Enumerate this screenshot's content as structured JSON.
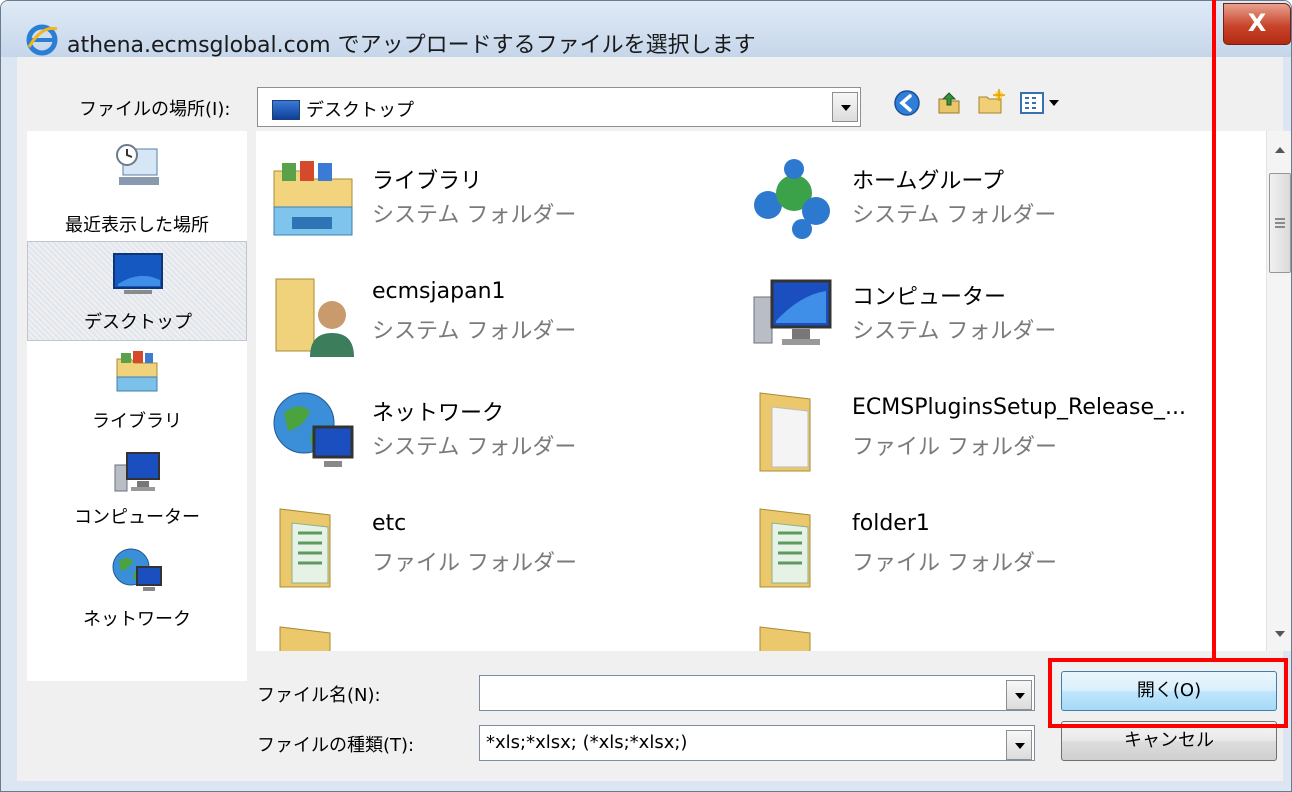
{
  "window": {
    "title": "athena.ecmsglobal.com でアップロードするファイルを選択します",
    "close_label": "X",
    "title_icon": "ie-icon"
  },
  "toolbar": {
    "location_label": "ファイルの場所(I):",
    "location_value": "デスクトップ",
    "icons": [
      "back-icon",
      "up-folder-icon",
      "new-folder-icon",
      "view-menu-icon"
    ]
  },
  "places": [
    {
      "label": "最近表示した場所",
      "icon": "recent-places-icon"
    },
    {
      "label": "デスクトップ",
      "icon": "desktop-icon",
      "selected": true
    },
    {
      "label": "ライブラリ",
      "icon": "libraries-icon"
    },
    {
      "label": "コンピューター",
      "icon": "computer-icon"
    },
    {
      "label": "ネットワーク",
      "icon": "network-icon"
    }
  ],
  "files": [
    {
      "name": "ライブラリ",
      "type": "システム フォルダー",
      "icon": "libraries-folder-icon"
    },
    {
      "name": "ホームグループ",
      "type": "システム フォルダー",
      "icon": "homegroup-icon"
    },
    {
      "name": "ecmsjapan1",
      "type": "システム フォルダー",
      "icon": "user-folder-icon"
    },
    {
      "name": "コンピューター",
      "type": "システム フォルダー",
      "icon": "computer-icon"
    },
    {
      "name": "ネットワーク",
      "type": "システム フォルダー",
      "icon": "network-icon"
    },
    {
      "name": "ECMSPluginsSetup_Release_...",
      "type": "ファイル フォルダー",
      "icon": "folder-icon"
    },
    {
      "name": "etc",
      "type": "ファイル フォルダー",
      "icon": "folder-icon"
    },
    {
      "name": "folder1",
      "type": "ファイル フォルダー",
      "icon": "folder-icon"
    }
  ],
  "bottom": {
    "filename_label": "ファイル名(N):",
    "filename_value": "",
    "filetype_label": "ファイルの種類(T):",
    "filetype_value": "*xls;*xlsx; (*xls;*xlsx;)",
    "open_label": "開く(O)",
    "cancel_label": "キャンセル"
  },
  "annotation": {
    "color": "#ff0000"
  }
}
